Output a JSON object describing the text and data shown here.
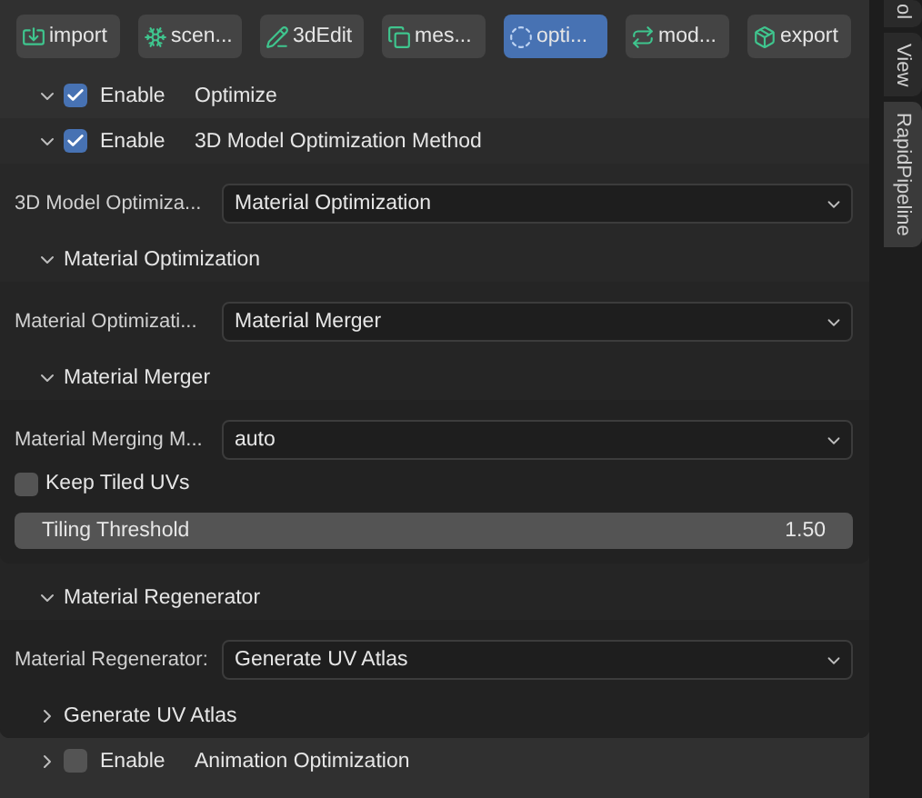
{
  "toolbar": [
    {
      "label": "import",
      "selected": false
    },
    {
      "label": "scen...",
      "selected": false
    },
    {
      "label": "3dEdit",
      "selected": false
    },
    {
      "label": "mes...",
      "selected": false
    },
    {
      "label": "opti...",
      "selected": true
    },
    {
      "label": "mod...",
      "selected": false
    },
    {
      "label": "export",
      "selected": false
    }
  ],
  "side_tabs": [
    {
      "label": "ol",
      "selected": false
    },
    {
      "label": "View",
      "selected": false
    },
    {
      "label": "RapidPipeline",
      "selected": true
    }
  ],
  "panels": [
    {
      "kind": "panel",
      "checkbox_label": "Enable",
      "title": "Optimize",
      "checked": true,
      "expanded": true,
      "children": [
        {
          "kind": "panel",
          "checkbox_label": "Enable",
          "title": "3D Model Optimization Method",
          "checked": true,
          "expanded": true,
          "children": [
            {
              "kind": "select",
              "label": "3D Model Optimiza...",
              "value": "Material Optimization"
            },
            {
              "kind": "subpanel",
              "title": "Material Optimization",
              "expanded": true,
              "children": [
                {
                  "kind": "select",
                  "label": "Material Optimizati...",
                  "value": "Material Merger"
                },
                {
                  "kind": "subpanel",
                  "title": "Material Merger",
                  "expanded": true,
                  "children": [
                    {
                      "kind": "select",
                      "label": "Material Merging M...",
                      "value": "auto"
                    },
                    {
                      "kind": "checkbox",
                      "label": "Keep Tiled UVs",
                      "checked": false
                    },
                    {
                      "kind": "number",
                      "label": "Tiling Threshold",
                      "value": "1.50"
                    }
                  ]
                },
                {
                  "kind": "subpanel",
                  "title": "Material Regenerator",
                  "expanded": true,
                  "children": [
                    {
                      "kind": "select",
                      "label": "Material Regenerator:",
                      "value": "Generate UV Atlas"
                    },
                    {
                      "kind": "subpanel",
                      "title": "Generate UV Atlas",
                      "expanded": false
                    }
                  ]
                }
              ]
            }
          ]
        }
      ]
    },
    {
      "kind": "panel",
      "checkbox_label": "Enable",
      "title": "Animation Optimization",
      "checked": false,
      "expanded": false
    }
  ]
}
